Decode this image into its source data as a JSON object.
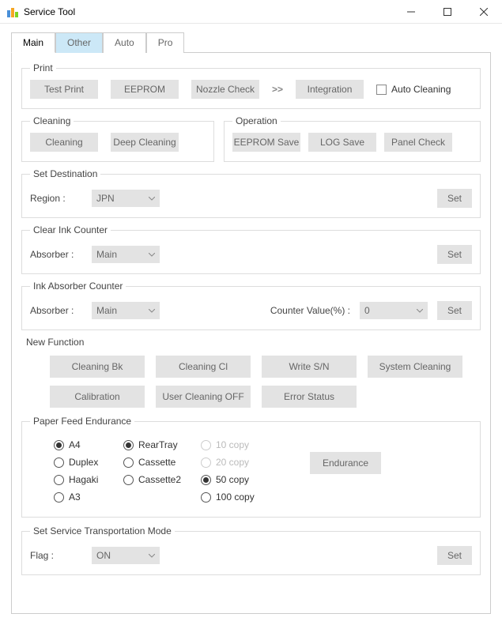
{
  "window": {
    "title": "Service Tool"
  },
  "tabs": [
    "Main",
    "Other",
    "Auto",
    "Pro"
  ],
  "print": {
    "legend": "Print",
    "btns": [
      "Test Print",
      "EEPROM",
      "Nozzle Check"
    ],
    "arrow": ">>",
    "integration": "Integration",
    "auto_cleaning": "Auto Cleaning"
  },
  "cleaning": {
    "legend": "Cleaning",
    "btns": [
      "Cleaning",
      "Deep Cleaning"
    ]
  },
  "operation": {
    "legend": "Operation",
    "btns": [
      "EEPROM Save",
      "LOG Save",
      "Panel Check"
    ]
  },
  "dest": {
    "legend": "Set Destination",
    "label": "Region :",
    "value": "JPN",
    "set": "Set"
  },
  "clearink": {
    "legend": "Clear Ink Counter",
    "label": "Absorber :",
    "value": "Main",
    "set": "Set"
  },
  "absorber": {
    "legend": "Ink Absorber Counter",
    "label": "Absorber :",
    "value": "Main",
    "cvlabel": "Counter Value(%) :",
    "cv": "0",
    "set": "Set"
  },
  "newfn": {
    "label": "New Function",
    "row1": [
      "Cleaning Bk",
      "Cleaning Cl",
      "Write S/N",
      "System Cleaning"
    ],
    "row2": [
      "Calibration",
      "User Cleaning OFF",
      "Error Status"
    ]
  },
  "pf": {
    "legend": "Paper Feed Endurance",
    "size": [
      "A4",
      "Duplex",
      "Hagaki",
      "A3"
    ],
    "size_sel": "A4",
    "tray": [
      "RearTray",
      "Cassette",
      "Cassette2"
    ],
    "tray_sel": "RearTray",
    "copy": [
      "10 copy",
      "20 copy",
      "50 copy",
      "100 copy"
    ],
    "copy_sel": "50 copy",
    "copy_disabled": [
      "10 copy",
      "20 copy"
    ],
    "endurance": "Endurance"
  },
  "transport": {
    "legend": "Set Service Transportation Mode",
    "label": "Flag :",
    "value": "ON",
    "set": "Set"
  }
}
